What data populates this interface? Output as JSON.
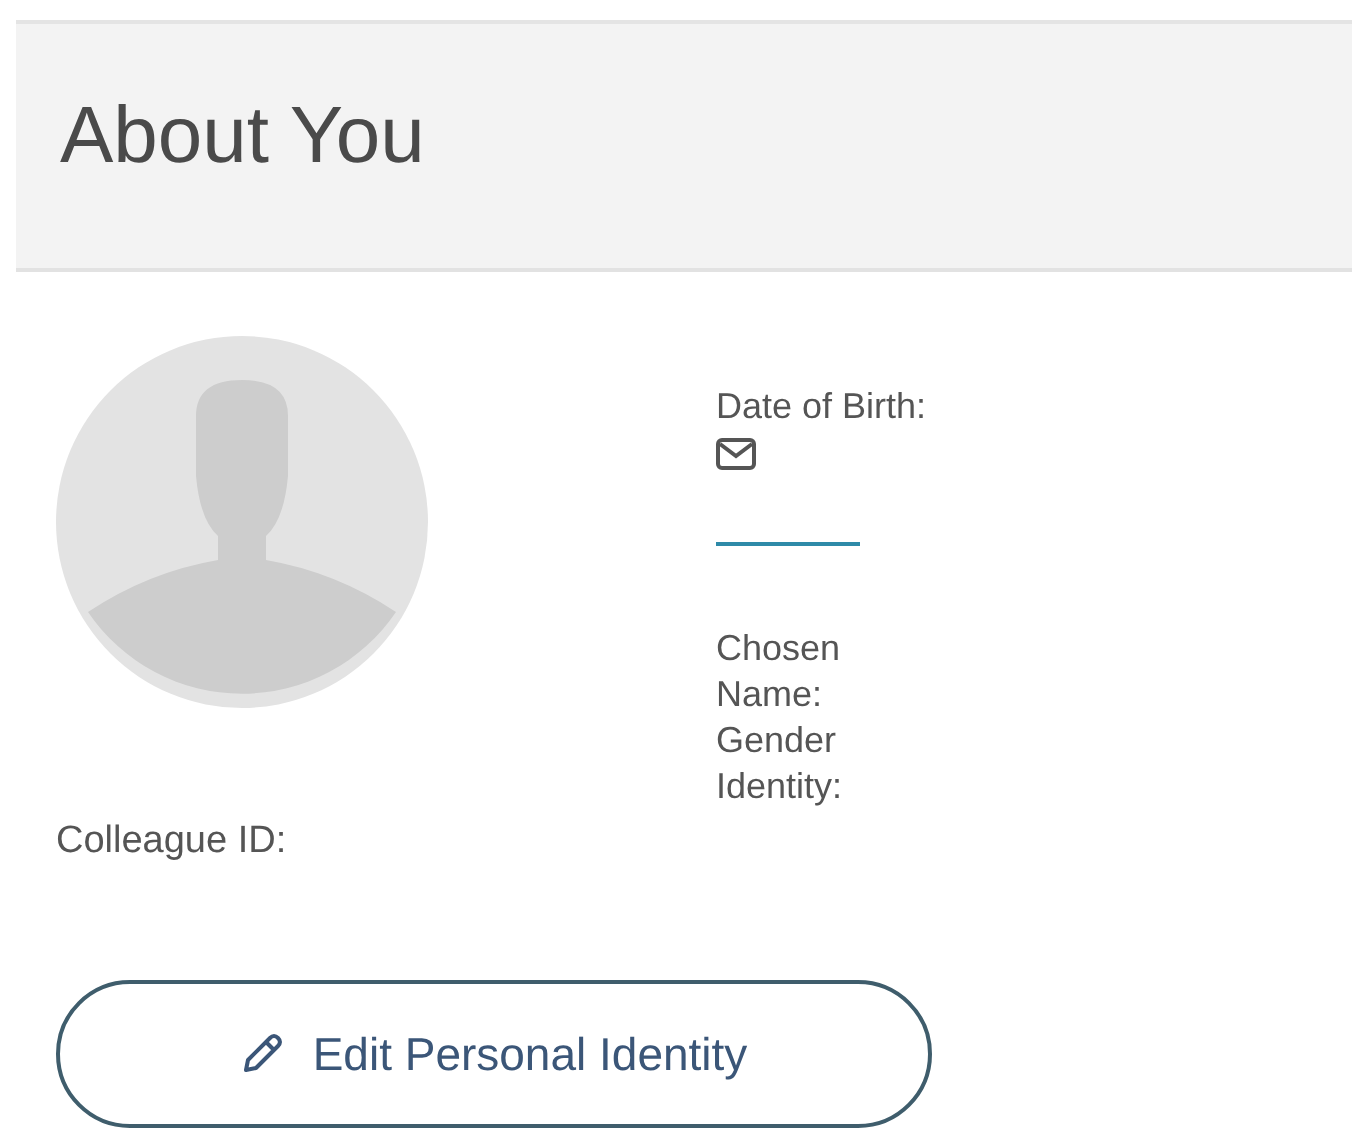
{
  "header": {
    "title": "About You"
  },
  "profile": {
    "colleague_id_label": "Colleague ID:"
  },
  "details": [
    {
      "kind": "label",
      "text": "Date of Birth:"
    },
    {
      "kind": "email_icon"
    },
    {
      "kind": "divider"
    },
    {
      "kind": "label",
      "text": "Chosen Name:"
    },
    {
      "kind": "label",
      "text": "Gender Identity:"
    }
  ],
  "edit_button": {
    "label": "Edit Personal Identity"
  }
}
